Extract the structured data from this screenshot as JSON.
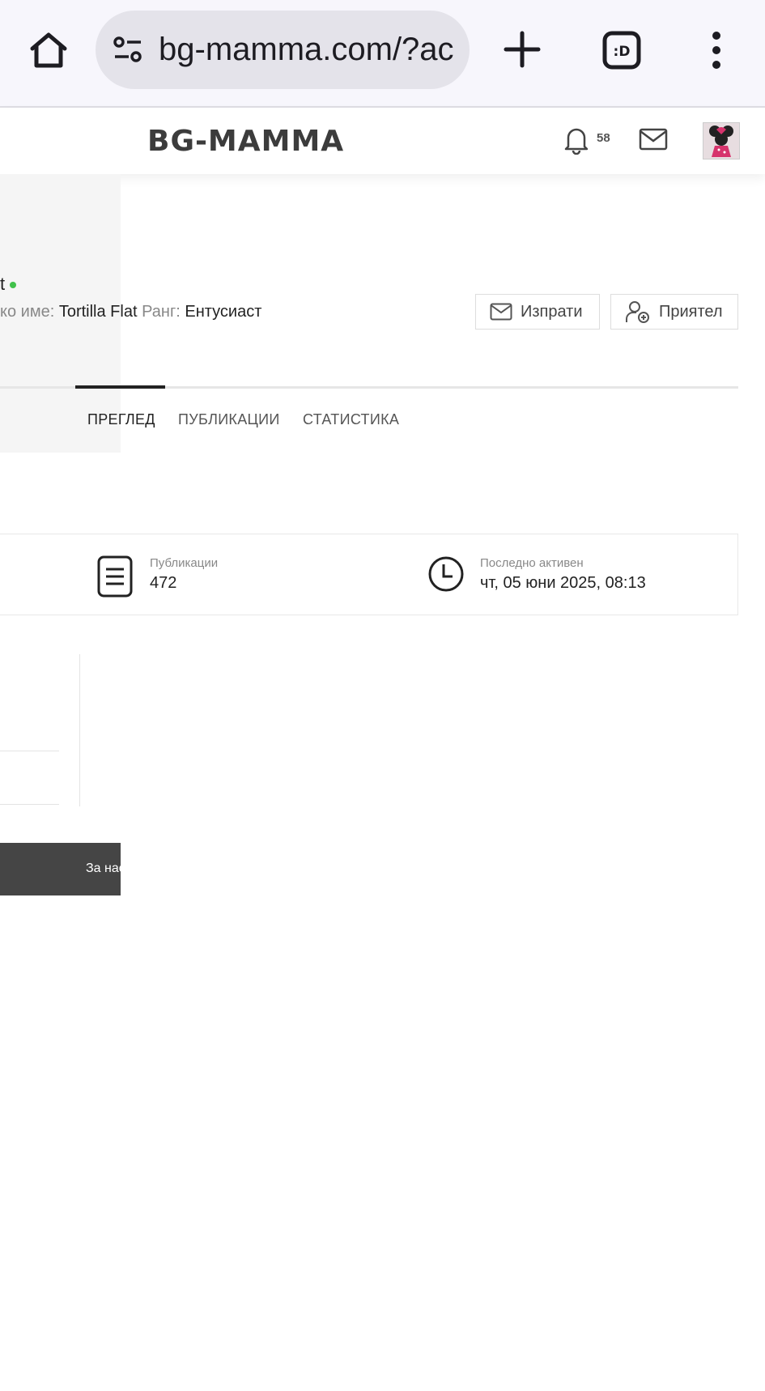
{
  "browser": {
    "url": "bg-mamma.com/?ac"
  },
  "header": {
    "logo": "BG-MAMMA",
    "notifications_count": "58"
  },
  "profile": {
    "name_fragment": "t",
    "username_label": "ко име:",
    "username": "Tortilla Flat",
    "rank_label": "Ранг:",
    "rank": "Ентусиаст",
    "send_button": "Изпрати",
    "friend_button": "Приятел"
  },
  "tabs": [
    {
      "label": "ПРЕГЛЕД",
      "active": true
    },
    {
      "label": "ПУБЛИКАЦИИ",
      "active": false
    },
    {
      "label": "СТАТИСТИКА",
      "active": false
    }
  ],
  "stats": {
    "posts_label": "Публикации",
    "posts_value": "472",
    "last_active_label": "Последно активен",
    "last_active_value": "чт, 05 юни 2025, 08:13"
  },
  "footer": {
    "link_fragment": "За нас"
  },
  "colors": {
    "online": "#41c14b",
    "footer_bg": "#454545",
    "chrome_bg": "#f7f6fc"
  }
}
